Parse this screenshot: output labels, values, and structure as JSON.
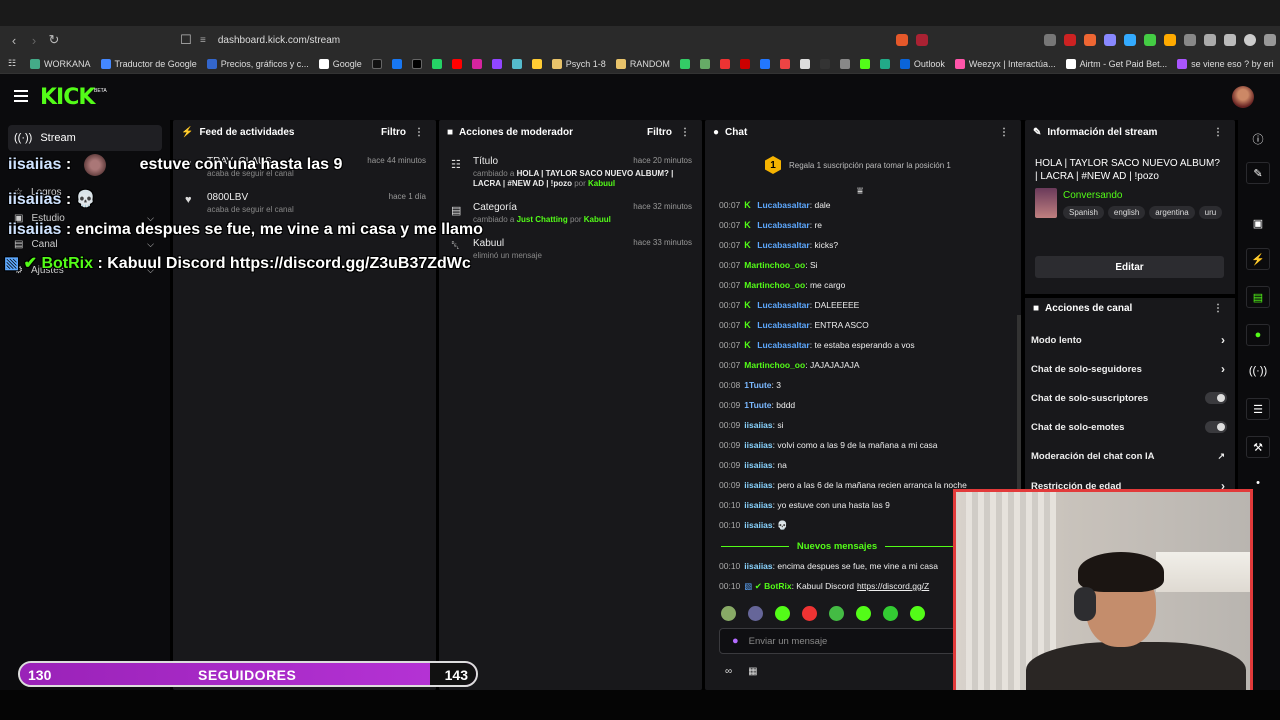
{
  "browser": {
    "url": "dashboard.kick.com/stream",
    "bookmarks": [
      "WORKANA",
      "Traductor de Google",
      "Precios, gráficos y c...",
      "Google",
      "Psych 1-8",
      "RANDOM",
      "Outlook",
      "Weezyx | Interactúa...",
      "Airtm - Get Paid Bet...",
      "se viene eso ? by eri"
    ]
  },
  "brand": {
    "logo": "KICK",
    "beta": "BETA",
    "accent": "#53fc18"
  },
  "sidebar": {
    "items": [
      {
        "label": "Stream",
        "icon": "stream-icon"
      },
      {
        "label": "Logros",
        "icon": "trophy-icon"
      },
      {
        "label": "Estudio",
        "icon": "studio-icon"
      },
      {
        "label": "Canal",
        "icon": "channel-icon"
      },
      {
        "label": "Ajustes",
        "icon": "settings-icon"
      }
    ]
  },
  "activity_feed": {
    "title": "Feed de actividades",
    "filter": "Filtro",
    "items": [
      {
        "name": "TRAV_CLAUS",
        "desc": "acaba de seguir el canal",
        "time": "hace 44 minutos"
      },
      {
        "name": "0800LBV",
        "desc": "acaba de seguir el canal",
        "time": "hace 1 día"
      }
    ]
  },
  "mod_actions": {
    "title": "Acciones de moderador",
    "filter": "Filtro",
    "items": [
      {
        "title": "Título",
        "prefix": "cambiado a",
        "value": "HOLA | TAYLOR SACO NUEVO ALBUM? | LACRA | #NEW AD | !pozo",
        "by": "por",
        "user": "Kabuul",
        "time": "hace 20 minutos"
      },
      {
        "title": "Categoría",
        "prefix": "cambiado a",
        "value": "Just Chatting",
        "by": "por",
        "user": "Kabuul",
        "time": "hace 32 minutos"
      },
      {
        "title": "Kabuul",
        "prefix": "",
        "value": "eliminó un mensaje",
        "by": "",
        "user": "",
        "time": "hace 33 minutos"
      }
    ]
  },
  "chat": {
    "title": "Chat",
    "promo": "Regala 1 suscripción para tomar la posición 1",
    "promo_rank": "1",
    "messages": [
      {
        "time": "00:07",
        "user": "Lucabasaltar",
        "text": "dale"
      },
      {
        "time": "00:07",
        "user": "Lucabasaltar",
        "text": "re"
      },
      {
        "time": "00:07",
        "user": "Lucabasaltar",
        "text": "kicks?"
      },
      {
        "time": "00:07",
        "user": "Martinchoo_oo",
        "text": "Si"
      },
      {
        "time": "00:07",
        "user": "Martinchoo_oo",
        "text": "me cargo"
      },
      {
        "time": "00:07",
        "user": "Lucabasaltar",
        "text": "DALEEEEE"
      },
      {
        "time": "00:07",
        "user": "Lucabasaltar",
        "text": "ENTRA ASCO"
      },
      {
        "time": "00:07",
        "user": "Lucabasaltar",
        "text": "te estaba esperando a vos"
      },
      {
        "time": "00:07",
        "user": "Martinchoo_oo",
        "text": "JAJAJAJAJA"
      },
      {
        "time": "00:08",
        "user": "1Tuute",
        "text": "3"
      },
      {
        "time": "00:09",
        "user": "1Tuute",
        "text": "bddd"
      },
      {
        "time": "00:09",
        "user": "iisaiias",
        "text": "si"
      },
      {
        "time": "00:09",
        "user": "iisaiias",
        "text": "volvi como a las 9 de la mañana a mi casa"
      },
      {
        "time": "00:09",
        "user": "iisaiias",
        "text": "na"
      },
      {
        "time": "00:09",
        "user": "iisaiias",
        "text": "pero a las 6 de la mañana recien arranca la noche"
      },
      {
        "time": "00:10",
        "user": "iisaiias",
        "text": "yo estuve con una hasta las 9"
      },
      {
        "time": "00:10",
        "user": "iisaiias",
        "text": "💀"
      }
    ],
    "new_messages_label": "Nuevos mensajes",
    "new_messages": [
      {
        "time": "00:10",
        "user": "iisaiias",
        "text": "encima despues se fue, me vine a mi casa"
      },
      {
        "time": "00:10",
        "user": "BotRix",
        "text": "Kabuul Discord",
        "link": "https://discord.gg/Z"
      }
    ],
    "input_placeholder": "Enviar un mensaje"
  },
  "stream_info": {
    "title": "Información del stream",
    "stream_title": "HOLA | TAYLOR SACO NUEVO ALBUM? | LACRA | #NEW AD | !pozo",
    "category": "Conversando",
    "tags": [
      "Spanish",
      "english",
      "argentina",
      "uru"
    ],
    "edit_label": "Editar"
  },
  "channel_actions": {
    "title": "Acciones de canal",
    "items": [
      {
        "label": "Modo lento",
        "control": "arrow"
      },
      {
        "label": "Chat de solo-seguidores",
        "control": "arrow"
      },
      {
        "label": "Chat de solo-suscriptores",
        "control": "toggle"
      },
      {
        "label": "Chat de solo-emotes",
        "control": "toggle"
      },
      {
        "label": "Moderación del chat con IA",
        "control": "external"
      },
      {
        "label": "Restricción de edad",
        "control": "arrow"
      }
    ]
  },
  "overlay": {
    "lines": [
      {
        "user": "iisaiias",
        "sep": ":",
        "text": "estuve con una hasta las 9"
      },
      {
        "user": "iisaiias",
        "sep": ":",
        "text": "💀"
      },
      {
        "user": "iisaiias",
        "sep": ":",
        "text": "encima despues se fue, me vine a mi casa y me llamo"
      },
      {
        "user": "BotRix",
        "sep": ":",
        "text": "Kabuul Discord https://discord.gg/Z3uB37ZdWc"
      }
    ],
    "follow_goal": {
      "current": "130",
      "label": "SEGUIDORES",
      "target": "143",
      "progress": 0.9
    }
  }
}
